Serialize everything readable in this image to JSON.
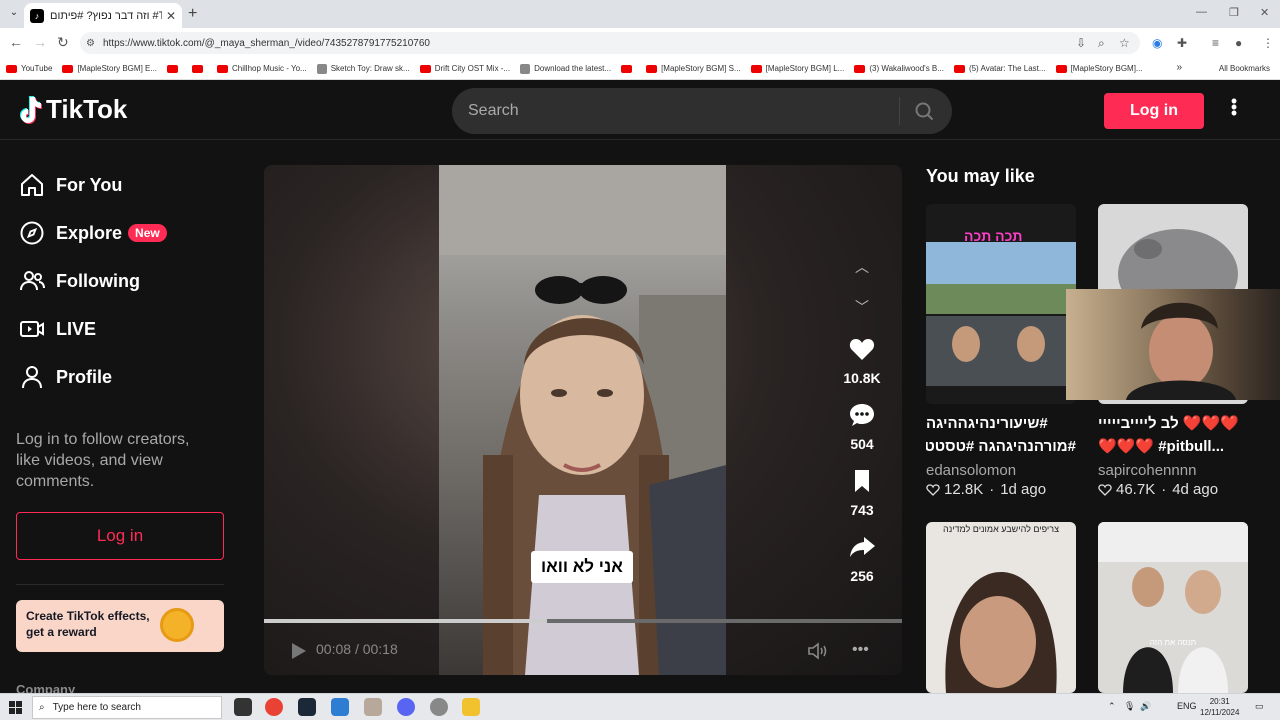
{
  "browser": {
    "tab_title": "וזה דבר נפוץ? #פיתום #TikTok | :",
    "url": "https://www.tiktok.com/@_maya_sherman_/video/7435278791775210760",
    "bookmarks": [
      {
        "label": "YouTube",
        "kind": "yt"
      },
      {
        "label": "[MapleStory BGM] E...",
        "kind": "yt"
      },
      {
        "label": "",
        "kind": "yt"
      },
      {
        "label": "",
        "kind": "yt"
      },
      {
        "label": "Chillhop Music - Yo...",
        "kind": "yt"
      },
      {
        "label": "Sketch Toy: Draw sk...",
        "kind": "gen"
      },
      {
        "label": "Drift City OST Mix -...",
        "kind": "yt"
      },
      {
        "label": "Download the latest...",
        "kind": "gen"
      },
      {
        "label": "",
        "kind": "yt"
      },
      {
        "label": "[MapleStory BGM] S...",
        "kind": "yt"
      },
      {
        "label": "[MapleStory BGM] L...",
        "kind": "yt"
      },
      {
        "label": "(3) Wakaliwood's B...",
        "kind": "yt"
      },
      {
        "label": "(5) Avatar: The Last...",
        "kind": "yt"
      },
      {
        "label": "[MapleStory BGM]...",
        "kind": "yt"
      }
    ],
    "all_bookmarks": "All Bookmarks",
    "more_bookmarks": "»"
  },
  "header": {
    "logo_text": "TikTok",
    "search_placeholder": "Search",
    "login_label": "Log in"
  },
  "sidebar": {
    "items": [
      {
        "label": "For You",
        "icon": "home-icon"
      },
      {
        "label": "Explore",
        "icon": "compass-icon",
        "badge": "New"
      },
      {
        "label": "Following",
        "icon": "users-icon"
      },
      {
        "label": "LIVE",
        "icon": "live-icon"
      },
      {
        "label": "Profile",
        "icon": "profile-icon"
      }
    ],
    "login_message": "Log in to follow creators, like videos, and view comments.",
    "login_label": "Log in",
    "effects_text": "Create TikTok effects, get a reward",
    "company_label": "Company"
  },
  "player": {
    "caption": "אני לא וואו",
    "current_time": "00:08",
    "duration": "00:18",
    "time_separator": "/",
    "progress_fraction": 0.444,
    "likes": "10.8K",
    "comments": "504",
    "saves": "743",
    "shares": "256"
  },
  "you_may_like": {
    "title": "You may like",
    "cards": [
      {
        "title1": "#שיעורינהיגההיגה",
        "title2": "#מורהנהיגהגה #טסטט",
        "user": "edansolomon",
        "likes": "12.8K",
        "age": "1d ago",
        "overlay_text": "תכה תכה"
      },
      {
        "title1": "❤️❤️❤️ לב לייייבייייי",
        "title2": "❤️❤️❤️ #pitbull...",
        "user": "sapircohennnn",
        "likes": "46.7K",
        "age": "4d ago"
      },
      {
        "overlay_text": "צריפים להישבע אמונים למדינה"
      },
      {
        "overlay_text": "תנסה את הזה"
      }
    ]
  },
  "taskbar": {
    "search_placeholder": "Type here to search",
    "lang": "ENG",
    "time": "20:31",
    "date": "12/11/2024"
  }
}
